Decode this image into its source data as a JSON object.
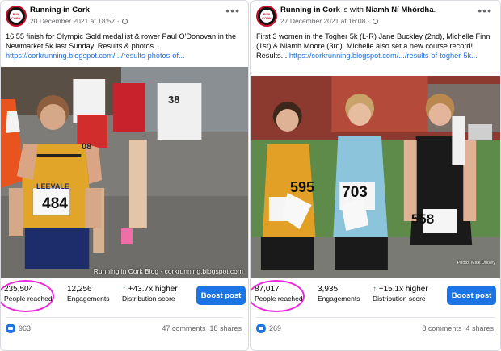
{
  "posts": [
    {
      "page_name": "Running in Cork",
      "with_text": "",
      "tagged_name": "",
      "timestamp": "20 December 2021 at 18:57",
      "caption_text": "16:55 finish for Olympic Gold medallist & rower Paul O'Donovan in the Newmarket 5k last Sunday. Results & photos...",
      "caption_link": "https://corkrunning.blogspot.com/.../results-photos-of...",
      "photo_watermark": "Running in Cork Blog - corkrunning.blogspot.com",
      "photo_credit": "",
      "bib_numbers": [
        "484",
        "38",
        "08"
      ],
      "jersey_text": "LEEVALE",
      "people_reached": "235,504",
      "people_reached_label": "People reached",
      "engagements": "12,256",
      "engagements_label": "Engagements",
      "distribution": "+43.7x higher",
      "distribution_label": "Distribution score",
      "boost_label": "Boost post",
      "likes": "963",
      "comments": "47 comments",
      "shares": "18 shares"
    },
    {
      "page_name": "Running in Cork",
      "with_text": " is with ",
      "tagged_name": "Niamh Ní Mhórdha",
      "timestamp": "27 December 2021 at 16:08",
      "caption_text": "First 3 women in the Togher 5k (L-R) Jane Buckley (2nd), Michelle Finn (1st) & Niamh Moore (3rd). Michelle also set a new course record! Results... ",
      "caption_link": "https://corkrunning.blogspot.com/.../results-of-togher-5k...",
      "photo_watermark": "",
      "photo_credit": "Photo: Mick Dooley",
      "bib_numbers": [
        "595",
        "703",
        "558"
      ],
      "jersey_text": "",
      "people_reached": "87,017",
      "people_reached_label": "People reached",
      "engagements": "3,935",
      "engagements_label": "Engagements",
      "distribution": "+15.1x higher",
      "distribution_label": "Distribution score",
      "boost_label": "Boost post",
      "likes": "269",
      "comments": "8 comments",
      "shares": "4 shares"
    }
  ],
  "colors": {
    "brand_blue": "#1b74e4",
    "link": "#216fdb",
    "highlight_circle": "#ec27e0",
    "up_arrow": "#31a24c"
  },
  "icons": [
    "avatar",
    "globe-icon",
    "more-icon",
    "up-arrow-icon",
    "like-icon"
  ]
}
